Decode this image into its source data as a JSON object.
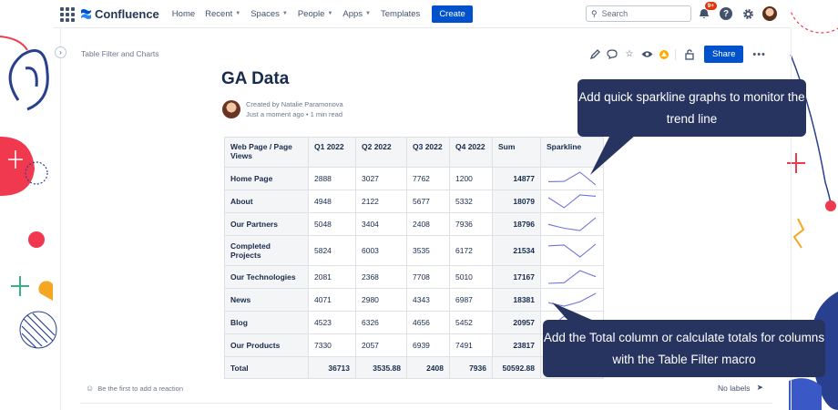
{
  "nav": {
    "logo_text": "Confluence",
    "items": [
      {
        "label": "Home",
        "has_menu": false
      },
      {
        "label": "Recent",
        "has_menu": true
      },
      {
        "label": "Spaces",
        "has_menu": true
      },
      {
        "label": "People",
        "has_menu": true
      },
      {
        "label": "Apps",
        "has_menu": true
      },
      {
        "label": "Templates",
        "has_menu": false
      }
    ],
    "create_label": "Create",
    "search_placeholder": "Search",
    "notification_badge": "9+"
  },
  "page": {
    "breadcrumb": "Table Filter and Charts",
    "share_label": "Share",
    "title": "GA Data",
    "author_line": "Created by Natalie Paramonova",
    "meta_line": "Just a moment ago • 1 min read",
    "reaction_text": "Be the first to add a reaction",
    "labels_text": "No labels"
  },
  "table": {
    "headers": [
      "Web Page / Page Views",
      "Q1 2022",
      "Q2 2022",
      "Q3 2022",
      "Q4 2022",
      "Sum",
      "Sparkline"
    ],
    "rows": [
      {
        "page": "Home Page",
        "q1": "2888",
        "q2": "3027",
        "q3": "7762",
        "q4": "1200",
        "sum": "14877",
        "trend": [
          2888,
          3027,
          7762,
          1200
        ]
      },
      {
        "page": "About",
        "q1": "4948",
        "q2": "2122",
        "q3": "5677",
        "q4": "5332",
        "sum": "18079",
        "trend": [
          4948,
          2122,
          5677,
          5332
        ]
      },
      {
        "page": "Our Partners",
        "q1": "5048",
        "q2": "3404",
        "q3": "2408",
        "q4": "7936",
        "sum": "18796",
        "trend": [
          5048,
          3404,
          2408,
          7936
        ]
      },
      {
        "page": "Completed Projects",
        "q1": "5824",
        "q2": "6003",
        "q3": "3535",
        "q4": "6172",
        "sum": "21534",
        "trend": [
          5824,
          6003,
          3535,
          6172
        ]
      },
      {
        "page": "Our Technologies",
        "q1": "2081",
        "q2": "2368",
        "q3": "7708",
        "q4": "5010",
        "sum": "17167",
        "trend": [
          2081,
          2368,
          7708,
          5010
        ]
      },
      {
        "page": "News",
        "q1": "4071",
        "q2": "2980",
        "q3": "4343",
        "q4": "6987",
        "sum": "18381",
        "trend": [
          4071,
          2980,
          4343,
          6987
        ]
      },
      {
        "page": "Blog",
        "q1": "4523",
        "q2": "6326",
        "q3": "4656",
        "q4": "5452",
        "sum": "20957",
        "trend": [
          4523,
          6326,
          4656,
          5452
        ]
      },
      {
        "page": "Our Products",
        "q1": "7330",
        "q2": "2057",
        "q3": "6939",
        "q4": "7491",
        "sum": "23817",
        "trend": [
          7330,
          2057,
          6939,
          7491
        ]
      }
    ],
    "total": {
      "label": "Total",
      "q1": "36713",
      "q2": "3535.88",
      "q3": "2408",
      "q4": "7936",
      "sum": "50592.88"
    }
  },
  "callouts": {
    "sparkline": "Add quick sparkline graphs to monitor the trend line",
    "totals": "Add the Total column or calculate totals for columns with the Table Filter macro"
  },
  "colors": {
    "primary": "#0052cc",
    "callout_bg": "#283460",
    "sparkline": "#6f74dd",
    "deco_red": "#f0384f",
    "deco_blue": "#28408f",
    "deco_orange": "#f5a623",
    "deco_green": "#36b37e"
  },
  "icons": {
    "apps": "apps-grid-icon",
    "search": "search-icon",
    "notifications": "bell-icon",
    "help": "help-icon",
    "settings": "gear-icon",
    "edit": "pencil-icon",
    "comment": "comment-icon",
    "star": "star-icon",
    "watch": "eye-icon",
    "restrictions": "lock-icon"
  }
}
